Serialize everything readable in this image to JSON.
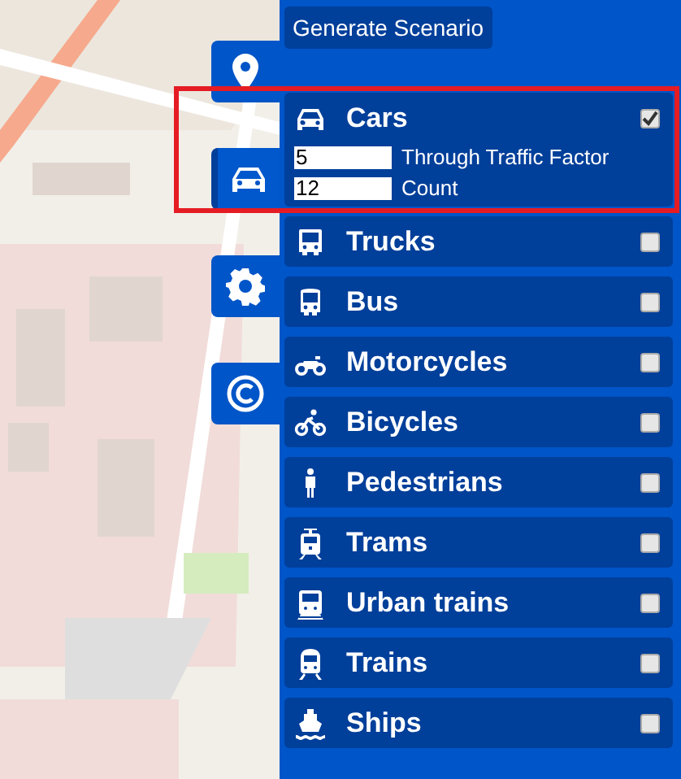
{
  "generate_button": {
    "label": "Generate Scenario"
  },
  "side_tabs": [
    {
      "selected": false
    },
    {
      "selected": true
    },
    {
      "selected": false
    },
    {
      "selected": false
    }
  ],
  "vehicles": [
    {
      "label": "Cars",
      "checked": true,
      "highlighted": true,
      "fields": [
        {
          "value": "5",
          "label": "Through Traffic Factor"
        },
        {
          "value": "12",
          "label": "Count"
        }
      ]
    },
    {
      "label": "Trucks",
      "checked": false,
      "highlighted": false
    },
    {
      "label": "Bus",
      "checked": false,
      "highlighted": false
    },
    {
      "label": "Motorcycles",
      "checked": false,
      "highlighted": false
    },
    {
      "label": "Bicycles",
      "checked": false,
      "highlighted": false
    },
    {
      "label": "Pedestrians",
      "checked": false,
      "highlighted": false
    },
    {
      "label": "Trams",
      "checked": false,
      "highlighted": false
    },
    {
      "label": "Urban trains",
      "checked": false,
      "highlighted": false
    },
    {
      "label": "Trains",
      "checked": false,
      "highlighted": false
    },
    {
      "label": "Ships",
      "checked": false,
      "highlighted": false
    }
  ]
}
